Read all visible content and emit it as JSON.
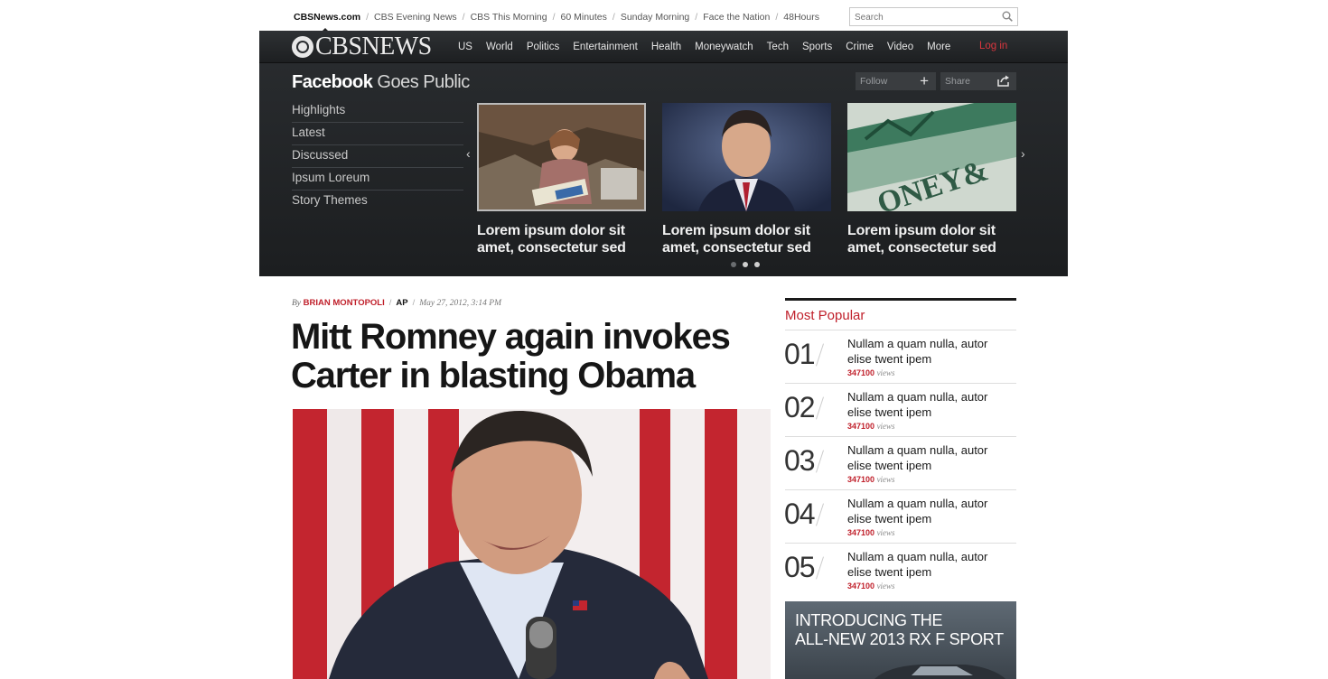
{
  "top_bar": {
    "links": [
      "CBSNews.com",
      "CBS Evening News",
      "CBS This Morning",
      "60 Minutes",
      "Sunday Morning",
      "Face the Nation",
      "48Hours"
    ],
    "search_placeholder": "Search"
  },
  "header": {
    "logo_text": "CBSNEWS",
    "nav": [
      "US",
      "World",
      "Politics",
      "Entertainment",
      "Health",
      "Moneywatch",
      "Tech",
      "Sports",
      "Crime",
      "Video",
      "More"
    ],
    "login_label": "Log in",
    "login_color": "#d9363e"
  },
  "feature": {
    "title_bold": "Facebook",
    "title_light": "Goes Public",
    "follow_label": "Follow",
    "share_label": "Share",
    "menu": [
      "Highlights",
      "Latest",
      "Discussed",
      "Ipsum Loreum",
      "Story Themes"
    ],
    "slides": [
      {
        "caption": "Lorem ipsum dolor sit amet, consectetur sed"
      },
      {
        "caption": "Lorem ipsum dolor sit amet, consectetur sed"
      },
      {
        "caption": "Lorem ipsum dolor sit amet, consectetur sed"
      }
    ],
    "active_dot": 1
  },
  "article": {
    "by": "By",
    "author": "Brian Montopoli",
    "source": "AP",
    "date": "May 27, 2012, 3:14 PM",
    "headline": "Mitt Romney again invokes Carter in blasting Obama"
  },
  "most_popular": {
    "title": "Most Popular",
    "items": [
      {
        "num": "01",
        "text": "Nullam a quam nulla, autor elise twent ipem",
        "views": "347100",
        "views_label": "views"
      },
      {
        "num": "02",
        "text": "Nullam a quam nulla, autor elise twent ipem",
        "views": "347100",
        "views_label": "views"
      },
      {
        "num": "03",
        "text": "Nullam a quam nulla, autor elise twent ipem",
        "views": "347100",
        "views_label": "views"
      },
      {
        "num": "04",
        "text": "Nullam a quam nulla, autor elise twent ipem",
        "views": "347100",
        "views_label": "views"
      },
      {
        "num": "05",
        "text": "Nullam a quam nulla, autor elise twent ipem",
        "views": "347100",
        "views_label": "views"
      }
    ]
  },
  "ad": {
    "line1": "INTRODUCING THE",
    "line2": "ALL-NEW 2013 RX F SPORT"
  },
  "colors": {
    "accent_red": "#c0202b",
    "header_dark": "#1c1e20"
  }
}
